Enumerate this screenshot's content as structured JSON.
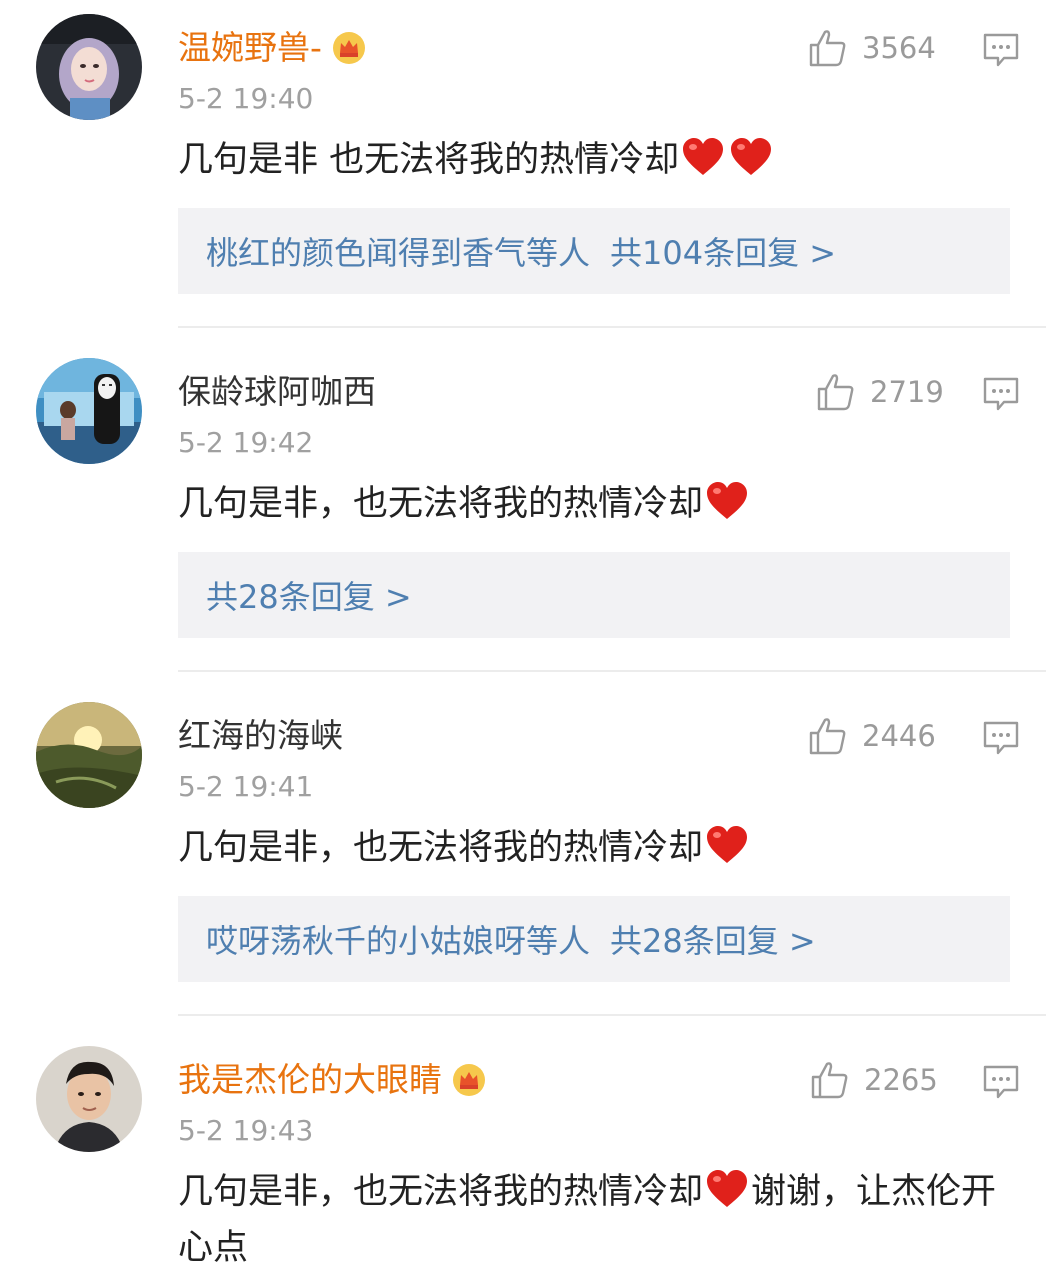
{
  "comments": [
    {
      "username": "温婉野兽-",
      "vip": true,
      "time": "5-2 19:40",
      "likes": "3564",
      "text_before": "几句是非 也无法将我的热情冷却",
      "hearts": 2,
      "text_after": "",
      "replies_prefix": "桃红的颜色闻得到香气等人",
      "replies_count": "共104条回复 >"
    },
    {
      "username": "保龄球阿咖西",
      "vip": false,
      "time": "5-2 19:42",
      "likes": "2719",
      "text_before": "几句是非，也无法将我的热情冷却",
      "hearts": 1,
      "text_after": "",
      "replies_prefix": "",
      "replies_count": "共28条回复 >"
    },
    {
      "username": "红海的海峡",
      "vip": false,
      "time": "5-2 19:41",
      "likes": "2446",
      "text_before": "几句是非，也无法将我的热情冷却",
      "hearts": 1,
      "text_after": "",
      "replies_prefix": "哎呀荡秋千的小姑娘呀等人",
      "replies_count": "共28条回复 >"
    },
    {
      "username": "我是杰伦的大眼睛",
      "vip": true,
      "time": "5-2 19:43",
      "likes": "2265",
      "text_before": "几句是非，也无法将我的热情冷却",
      "hearts": 1,
      "text_after": "谢谢，让杰伦开心点",
      "replies_prefix": "",
      "replies_count": ""
    }
  ],
  "icons": {
    "like": "thumbs-up-icon",
    "reply": "comment-bubble-icon",
    "heart": "red-heart-icon",
    "vip": "crown-badge-icon"
  },
  "colors": {
    "vip_name": "#e8730f",
    "reply_link": "#4f7fb0",
    "meta": "#a0a0a0",
    "heart": "#e0211b"
  }
}
